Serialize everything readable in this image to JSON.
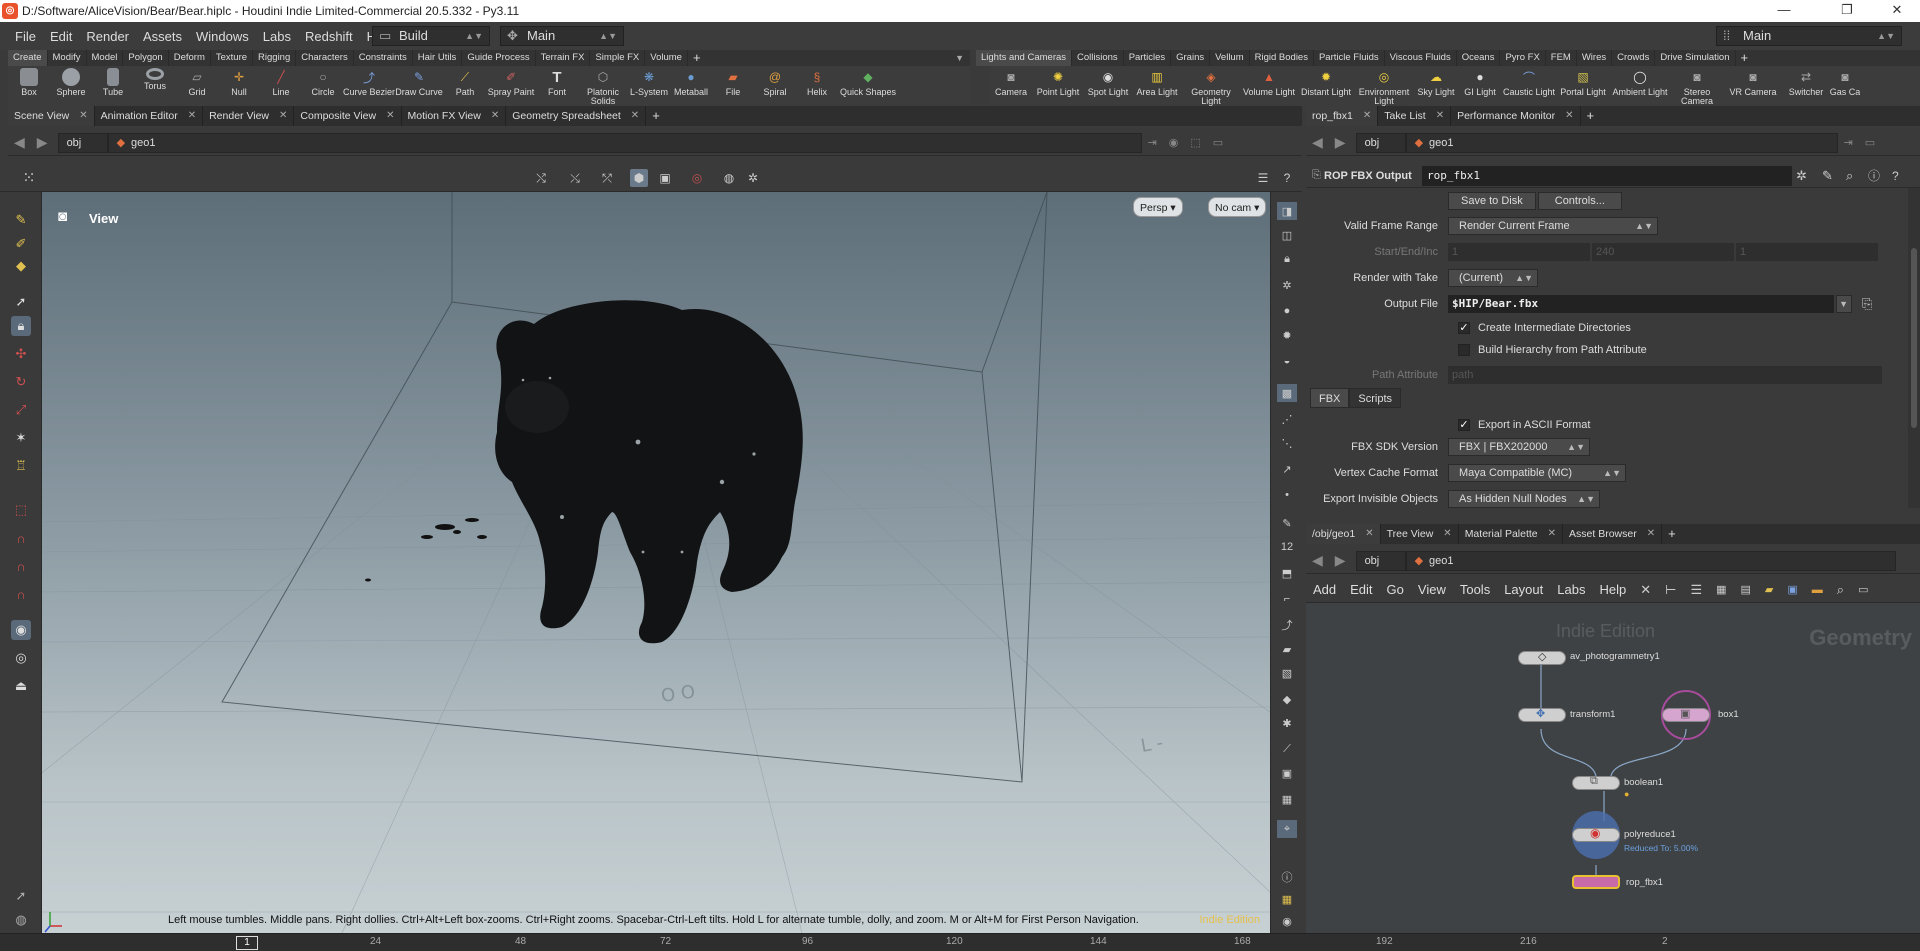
{
  "window": {
    "title": "D:/Software/AliceVision/Bear/Bear.hiplc - Houdini Indie Limited-Commercial 20.5.332 - Py3.11",
    "minimize": "—",
    "maximize": "❐",
    "close": "✕"
  },
  "menubar": {
    "items": [
      "File",
      "Edit",
      "Render",
      "Assets",
      "Windows",
      "Labs",
      "Redshift",
      "Help"
    ],
    "build_select": "Build",
    "main_select": "Main",
    "desktop_select": "Main"
  },
  "shelf_left": {
    "tabs": [
      "Create",
      "Modify",
      "Model",
      "Polygon",
      "Deform",
      "Texture",
      "Rigging",
      "Characters",
      "Constraints",
      "Hair Utils",
      "Guide Process",
      "Terrain FX",
      "Simple FX",
      "Volume"
    ],
    "tools": [
      "Box",
      "Sphere",
      "Tube",
      "Torus",
      "Grid",
      "Null",
      "Line",
      "Circle",
      "Curve Bezier",
      "Draw Curve",
      "Path",
      "Spray Paint",
      "Font",
      "Platonic Solids",
      "L-System",
      "Metaball",
      "File",
      "Spiral",
      "Helix",
      "Quick Shapes"
    ]
  },
  "shelf_right": {
    "tabs": [
      "Lights and Cameras",
      "Collisions",
      "Particles",
      "Grains",
      "Vellum",
      "Rigid Bodies",
      "Particle Fluids",
      "Viscous Fluids",
      "Oceans",
      "Pyro FX",
      "FEM",
      "Wires",
      "Crowds",
      "Drive Simulation"
    ],
    "tools": [
      "Camera",
      "Point Light",
      "Spot Light",
      "Area Light",
      "Geometry Light",
      "Volume Light",
      "Distant Light",
      "Environment Light",
      "Sky Light",
      "GI Light",
      "Caustic Light",
      "Portal Light",
      "Ambient Light",
      "Stereo Camera",
      "VR Camera",
      "Switcher",
      "Gas Ca"
    ]
  },
  "left_pane": {
    "tabs": [
      "Scene View",
      "Animation Editor",
      "Render View",
      "Composite View",
      "Motion FX View",
      "Geometry Spreadsheet"
    ],
    "path": [
      "obj",
      "geo1"
    ],
    "viewport": {
      "label": "View",
      "persp": "Persp ▾",
      "cam": "No cam ▾",
      "help": "Left mouse tumbles. Middle pans. Right dollies. Ctrl+Alt+Left box-zooms. Ctrl+Right zooms. Spacebar-Ctrl-Left tilts. Hold L for alternate tumble, dolly, and zoom. M or Alt+M for First Person Navigation.",
      "edition": "Indie Edition"
    }
  },
  "param_pane": {
    "tabs": [
      "rop_fbx1",
      "Take List",
      "Performance Monitor"
    ],
    "path": [
      "obj",
      "geo1"
    ],
    "node_type": "ROP FBX Output",
    "node_name": "rop_fbx1",
    "buttons": [
      "Save to Disk",
      "Controls..."
    ],
    "rows": {
      "valid_frame_range": {
        "label": "Valid Frame Range",
        "value": "Render Current Frame"
      },
      "start_end_inc": {
        "label": "Start/End/Inc",
        "values": [
          "1",
          "240",
          "1"
        ]
      },
      "render_with_take": {
        "label": "Render with Take",
        "value": "(Current)"
      },
      "output_file": {
        "label": "Output File",
        "value": "$HIP/Bear.fbx"
      },
      "create_dirs": {
        "label": "Create Intermediate Directories",
        "checked": true
      },
      "build_hierarchy": {
        "label": "Build Hierarchy from Path Attribute",
        "checked": false
      },
      "path_attribute": {
        "label": "Path Attribute",
        "placeholder": "path"
      }
    },
    "subtabs": [
      "FBX",
      "Scripts"
    ],
    "fbx": {
      "ascii": {
        "label": "Export in ASCII Format",
        "checked": true
      },
      "sdk_version": {
        "label": "FBX SDK Version",
        "value": "FBX | FBX202000"
      },
      "vertex_cache": {
        "label": "Vertex Cache Format",
        "value": "Maya Compatible (MC)"
      },
      "invisible": {
        "label": "Export Invisible Objects",
        "value": "As Hidden Null Nodes"
      }
    }
  },
  "network_pane": {
    "tabs": [
      "/obj/geo1",
      "Tree View",
      "Material Palette",
      "Asset Browser"
    ],
    "path": [
      "obj",
      "geo1"
    ],
    "menu": [
      "Add",
      "Edit",
      "Go",
      "View",
      "Tools",
      "Layout",
      "Labs",
      "Help"
    ],
    "watermark_edition": "Indie Edition",
    "watermark_context": "Geometry",
    "nodes": {
      "photogrammetry": "av_photogrammetry1",
      "transform": "transform1",
      "box": "box1",
      "boolean": "boolean1",
      "polyreduce": "polyreduce1",
      "polyreduce_note": "Reduced To: 5.00%",
      "rop": "rop_fbx1"
    }
  },
  "timeline": {
    "current_frame": "1",
    "ticks": [
      "24",
      "48",
      "72",
      "96",
      "120",
      "144",
      "168",
      "192",
      "216",
      "2"
    ]
  }
}
